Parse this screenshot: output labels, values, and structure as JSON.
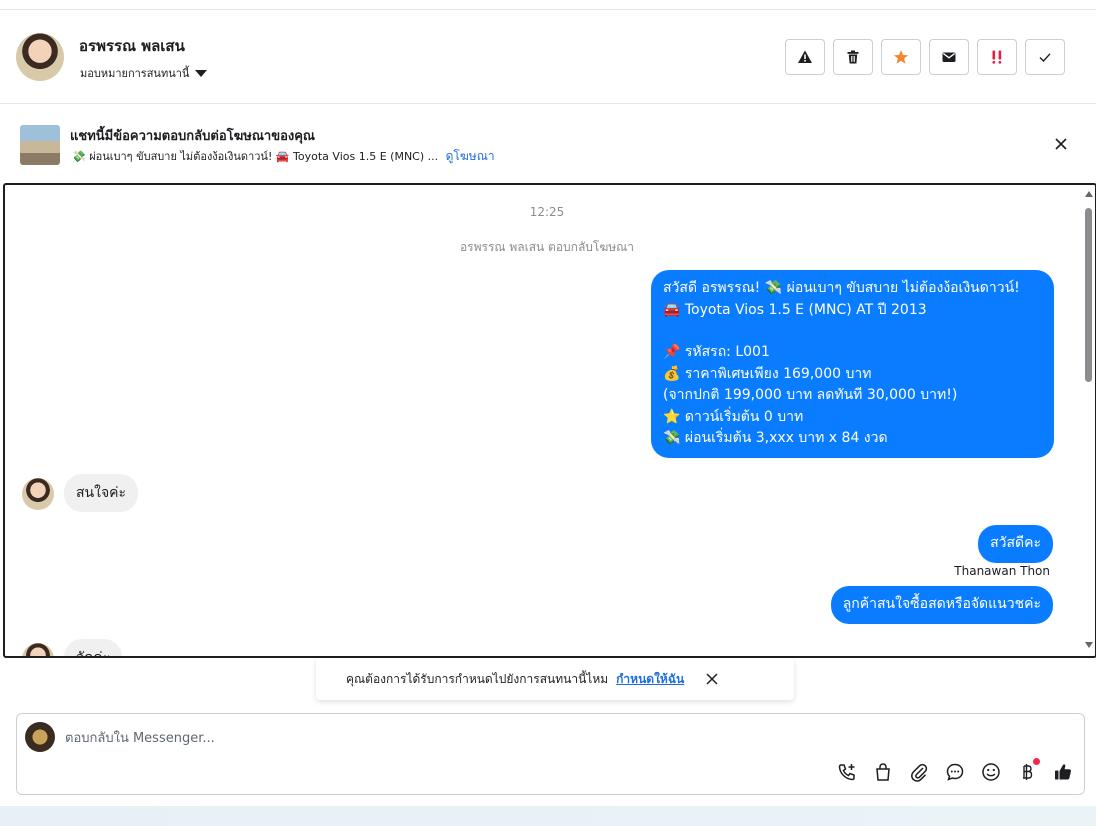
{
  "header": {
    "contact_name": "อรพรรณ พลเสน",
    "assign_label": "มอบหมายการสนทนานี้"
  },
  "actions": [
    "spam-icon",
    "trash-icon",
    "star-icon",
    "mail-icon",
    "important-icon",
    "done-icon"
  ],
  "ad_banner": {
    "title": "แชทนี้มีข้อความตอบกลับต่อโฆษณาของคุณ",
    "description": "💸 ผ่อนเบาๆ ขับสบาย ไม่ต้องง้อเงินดาวน์! 🚘 Toyota Vios 1.5 E (MNC) ...",
    "link": "ดูโฆษณา"
  },
  "chat": {
    "timestamp": "12:25",
    "replied_note": "อรพรรณ พลเสน ตอบกลับโฆษณา",
    "ad_message_lines": [
      "สวัสดี อรพรรณ! 💸 ผ่อนเบาๆ ขับสบาย ไม่ต้องง้อเงินดาวน์!",
      "🚘 Toyota Vios 1.5 E (MNC) AT ปี 2013",
      "",
      "📌 รหัสรถ: L001",
      "💰 ราคาพิเศษเพียง 169,000 บาท",
      "(จากปกติ 199,000 บาท ลดทันที 30,000 บาท!)",
      "⭐ ดาวน์เริ่มต้น 0 บาท",
      "💸 ผ่อนเริ่มต้น 3,xxx บาท x 84 งวด"
    ],
    "incoming_1": "สนใจค่ะ",
    "outgoing_1": "สวัสดีคะ",
    "sender_name": "Thanawan Thon",
    "outgoing_2": "ลูกค้าสนใจซื้อสดหรือจัดแนวชค่ะ",
    "incoming_2": "จัดค่ะ"
  },
  "toast": {
    "text": "คุณต้องการได้รับการกำหนดไปยังการสนทนานี้ไหม",
    "link": "กำหนดให้ฉัน"
  },
  "composer": {
    "placeholder": "ตอบกลับใน Messenger..."
  },
  "colors": {
    "outgoing_bubble": "#0a7cff",
    "incoming_bubble": "#f0f0f0",
    "link": "#216fdb",
    "star": "#f5862e",
    "important": "#e41e3f"
  }
}
